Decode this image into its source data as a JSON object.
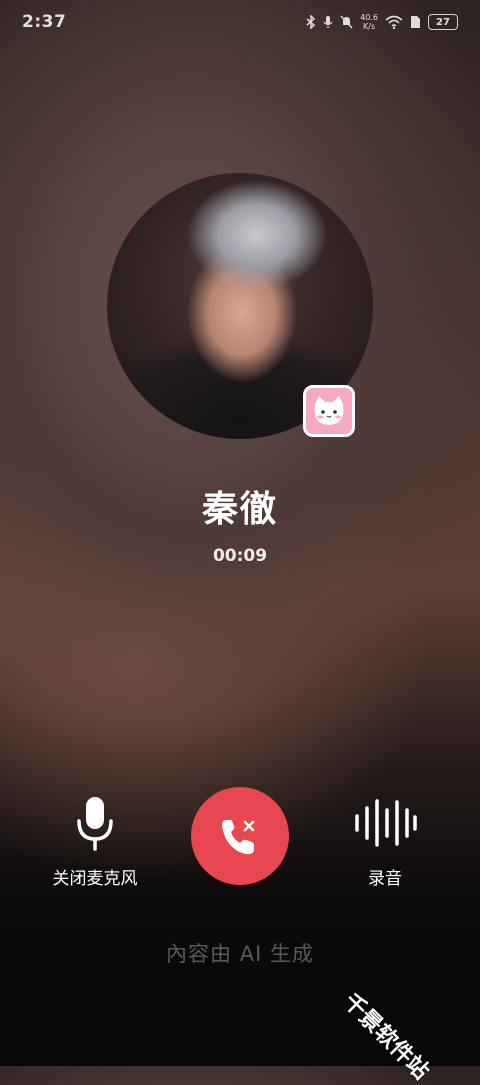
{
  "status_bar": {
    "time": "2:37",
    "net_speed_value": "40.6",
    "net_speed_unit": "K/s",
    "battery_level": "27",
    "icons": [
      "bluetooth-icon",
      "mic-icon",
      "mute-bell-icon",
      "wifi-icon",
      "sim-icon",
      "battery-icon"
    ]
  },
  "contact": {
    "name": "秦徹",
    "call_duration": "00:09"
  },
  "controls": {
    "mute_label": "关闭麦克风",
    "record_label": "录音",
    "hangup_icon": "phone-hangup-icon"
  },
  "footer": {
    "ai_notice": "內容由 AI 生成",
    "watermark": "千景软件站"
  },
  "colors": {
    "hangup": "#e9474f",
    "badge": "#f7a8c4"
  }
}
